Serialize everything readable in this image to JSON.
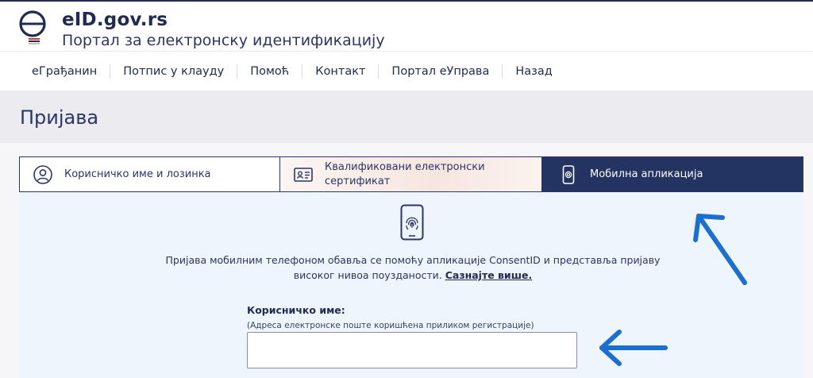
{
  "header": {
    "brand": "eID.gov.rs",
    "subtitle": "Портал за електронску идентификацију"
  },
  "nav": {
    "items": [
      "еГрађанин",
      "Потпис у клауду",
      "Помоћ",
      "Контакт",
      "Портал еУправа",
      "Назад"
    ]
  },
  "page": {
    "title": "Пријава"
  },
  "tabs": [
    {
      "label": "Корисничко име и лозинка",
      "icon": "user-circle-icon"
    },
    {
      "label": "Квалификовани електронски сертификат",
      "icon": "id-card-icon"
    },
    {
      "label": "Мобилна апликација",
      "icon": "mobile-phone-icon",
      "selected": true
    }
  ],
  "mobile": {
    "icon": "fingerprint-phone-icon",
    "description": "Пријава мобилним телефоном обавља се помоћу апликације ConsentID и представља пријаву високог нивоа поузданости.",
    "learn_more": "Сазнајте више."
  },
  "form": {
    "username_label": "Корисничко име:",
    "username_hint": "(Адреса електронске поште коришћена приликом регистрације)",
    "username_value": "",
    "username_placeholder": ""
  },
  "colors": {
    "primary": "#243462",
    "panel": "#eef5fc",
    "annotation_arrow": "#1b6fd1"
  }
}
